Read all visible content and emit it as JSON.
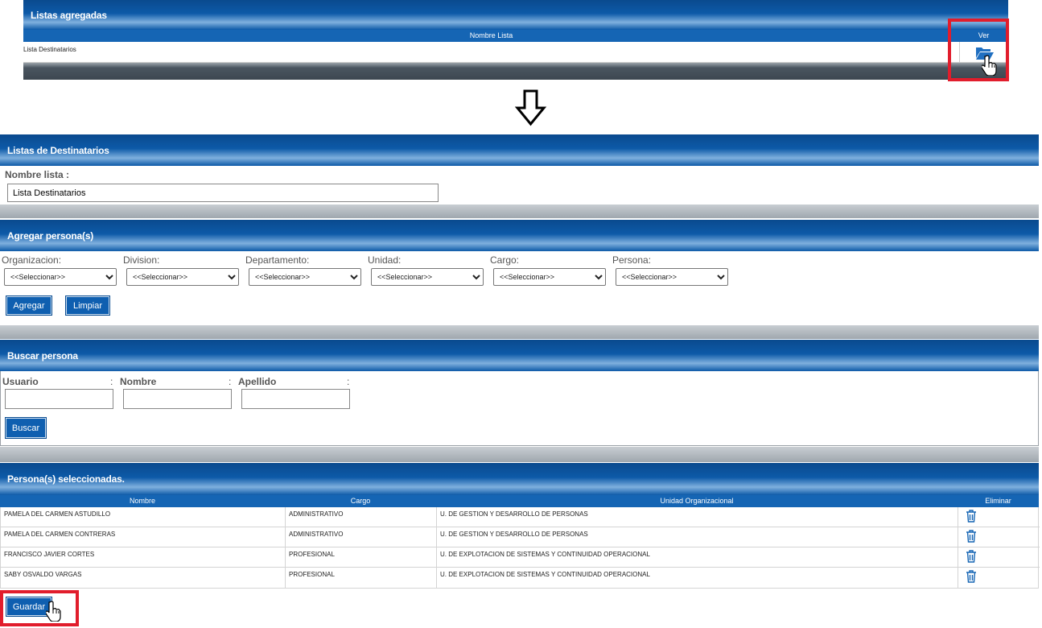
{
  "listas_agregadas": {
    "title": "Listas agregadas",
    "col_nombre": "Nombre Lista",
    "col_ver": "Ver",
    "row_name": "Lista Destinatarios",
    "view_icon": "open-folder-icon"
  },
  "arrow_icon": "down-arrow-icon",
  "listas_destinatarios": {
    "title": "Listas de Destinatarios",
    "nombre_label": "Nombre lista :",
    "nombre_value": "Lista Destinatarios"
  },
  "agregar": {
    "title": "Agregar persona(s)",
    "filters": [
      {
        "label": "Organizacion:",
        "value": "<<Seleccionar>>"
      },
      {
        "label": "Division:",
        "value": "<<Seleccionar>>"
      },
      {
        "label": "Departamento:",
        "value": "<<Seleccionar>>"
      },
      {
        "label": "Unidad:",
        "value": "<<Seleccionar>>"
      },
      {
        "label": "Cargo:",
        "value": "<<Seleccionar>>"
      },
      {
        "label": "Persona:",
        "value": "<<Seleccionar>>"
      }
    ],
    "agregar_btn": "Agregar",
    "limpiar_btn": "Limpiar"
  },
  "buscar": {
    "title": "Buscar persona",
    "usuario_label": "Usuario",
    "nombre_label": "Nombre",
    "apellido_label": "Apellido",
    "colon": ":",
    "buscar_btn": "Buscar"
  },
  "seleccionadas": {
    "title": "Persona(s) seleccionadas.",
    "col_nombre": "Nombre",
    "col_cargo": "Cargo",
    "col_unidad": "Unidad Organizacional",
    "col_eliminar": "Eliminar",
    "rows": [
      {
        "nombre": "PAMELA DEL CARMEN ASTUDILLO",
        "cargo": "ADMINISTRATIVO",
        "unidad": "U. DE GESTION Y DESARROLLO DE PERSONAS"
      },
      {
        "nombre": "PAMELA DEL CARMEN CONTRERAS",
        "cargo": "ADMINISTRATIVO",
        "unidad": "U. DE GESTION Y DESARROLLO DE PERSONAS"
      },
      {
        "nombre": "FRANCISCO JAVIER CORTES",
        "cargo": "PROFESIONAL",
        "unidad": "U. DE EXPLOTACION DE SISTEMAS Y CONTINUIDAD OPERACIONAL"
      },
      {
        "nombre": "SABY OSVALDO VARGAS",
        "cargo": "PROFESIONAL",
        "unidad": "U. DE EXPLOTACION DE SISTEMAS Y CONTINUIDAD OPERACIONAL"
      }
    ],
    "delete_icon": "trash-icon",
    "guardar_btn": "Guardar"
  },
  "colors": {
    "header_blue": "#0d5aa8",
    "table_head": "#1565b4",
    "highlight_red": "#e11d2c"
  }
}
